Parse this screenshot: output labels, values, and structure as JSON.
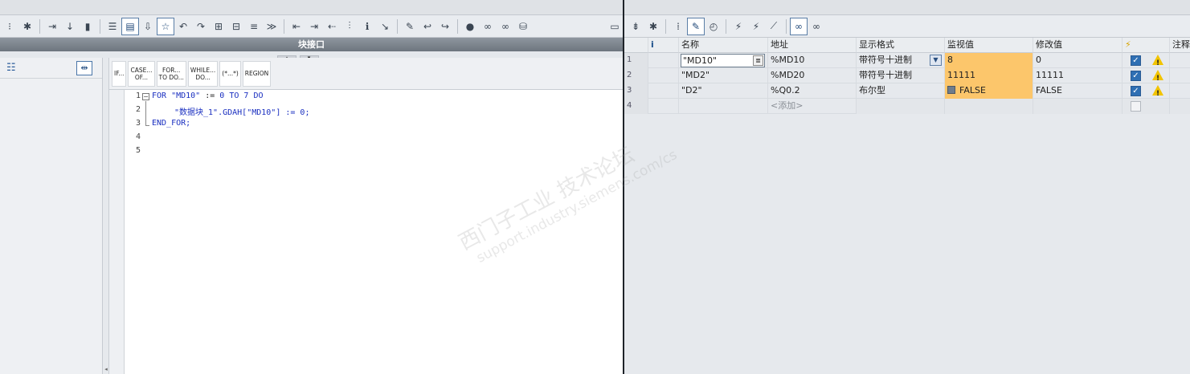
{
  "block_window": {
    "title": "块接口"
  },
  "instruction_buttons": [
    {
      "line1": "IF...",
      "line2": ""
    },
    {
      "line1": "CASE...",
      "line2": "OF..."
    },
    {
      "line1": "FOR...",
      "line2": "TO DO..."
    },
    {
      "line1": "WHILE...",
      "line2": "DO..."
    },
    {
      "line1": "(*...*)",
      "line2": ""
    },
    {
      "line1": "REGION",
      "line2": ""
    }
  ],
  "code": {
    "line_numbers": [
      "1",
      "2",
      "3",
      "4",
      "5"
    ],
    "line1": {
      "kw1": "FOR",
      "var": " \"MD10\"",
      "assign": " :=",
      "n0": " 0",
      "kw2": " TO",
      "n7": " 7",
      "kw3": " DO"
    },
    "line2": {
      "text": "\"数据块_1\".GDAH[\"MD10\"] := 0;"
    },
    "line3": {
      "text": "END_FOR;"
    }
  },
  "watch_table": {
    "headers": {
      "idx": "",
      "info": "i",
      "name": "名称",
      "address": "地址",
      "format": "显示格式",
      "monitor": "监视值",
      "modify": "修改值",
      "flash": "⚡",
      "comment": "注释"
    },
    "rows": [
      {
        "idx": "1",
        "name": "\"MD10\"",
        "address": "%MD10",
        "format": "带符号十进制",
        "monitor": "8",
        "modify": "0",
        "checked": true,
        "warning": true
      },
      {
        "idx": "2",
        "name": "\"MD2\"",
        "address": "%MD20",
        "format": "带符号十进制",
        "monitor": "11111",
        "modify": "11111",
        "checked": true,
        "warning": true
      },
      {
        "idx": "3",
        "name": "\"D2\"",
        "address": "%Q0.2",
        "format": "布尔型",
        "monitor": "FALSE",
        "modify": "FALSE",
        "checked": true,
        "warning": true
      },
      {
        "idx": "4",
        "name": "",
        "address": "<添加>",
        "format": "",
        "monitor": "",
        "modify": "",
        "checked": false,
        "warning": false
      }
    ]
  },
  "watermark": {
    "line1": "西门子工业   技术论坛",
    "line2": "support.industry.siemens.com/cs"
  },
  "colors": {
    "monitor_highlight": "#fcc66b",
    "keyword_blue": "#1a2fc0",
    "header_bar": "#7a828b"
  }
}
